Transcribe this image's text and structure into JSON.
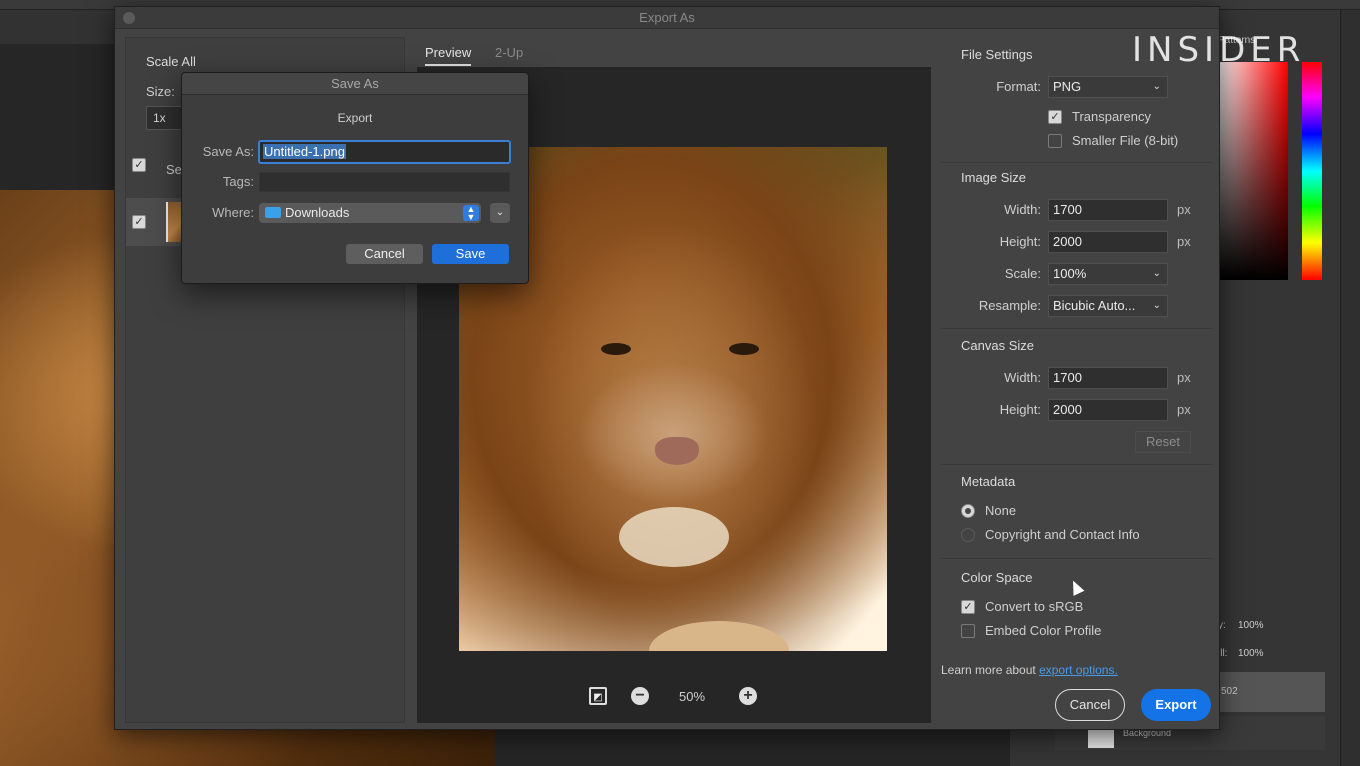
{
  "watermark": "INSIDER",
  "background_panel": {
    "tab_label": "Patterns",
    "opacity_label": "y:",
    "opacity_value": "100%",
    "fill_label": "ill:",
    "fill_value": "100%",
    "layer_name_fragment": "502",
    "background_layer": "Background"
  },
  "export_dialog": {
    "title": "Export As",
    "scale_all": "Scale All",
    "size_label": "Size:",
    "size_value": "1x",
    "select_label": "Sele",
    "tabs": {
      "preview": "Preview",
      "two_up": "2-Up"
    },
    "zoom_value": "50%",
    "file_settings": {
      "title": "File Settings",
      "format_label": "Format:",
      "format_value": "PNG",
      "transparency": "Transparency",
      "smaller_file": "Smaller File (8-bit)"
    },
    "image_size": {
      "title": "Image Size",
      "width_label": "Width:",
      "width_value": "1700",
      "height_label": "Height:",
      "height_value": "2000",
      "scale_label": "Scale:",
      "scale_value": "100%",
      "resample_label": "Resample:",
      "resample_value": "Bicubic Auto...",
      "unit": "px"
    },
    "canvas_size": {
      "title": "Canvas Size",
      "width_label": "Width:",
      "width_value": "1700",
      "height_label": "Height:",
      "height_value": "2000",
      "unit": "px",
      "reset": "Reset"
    },
    "metadata": {
      "title": "Metadata",
      "none": "None",
      "copyright": "Copyright and Contact Info"
    },
    "color_space": {
      "title": "Color Space",
      "convert": "Convert to sRGB",
      "embed": "Embed Color Profile"
    },
    "learn_more": "Learn more about",
    "learn_link": "export options.",
    "cancel": "Cancel",
    "export": "Export"
  },
  "save_as": {
    "title": "Save As",
    "subtitle": "Export",
    "name_label": "Save As:",
    "name_value": "Untitled-1.png",
    "tags_label": "Tags:",
    "where_label": "Where:",
    "where_value": "Downloads",
    "cancel": "Cancel",
    "save": "Save"
  },
  "colors": {
    "accent": "#1473e6",
    "dialog_bg": "#434343",
    "focus_ring": "#3a7ed6"
  }
}
